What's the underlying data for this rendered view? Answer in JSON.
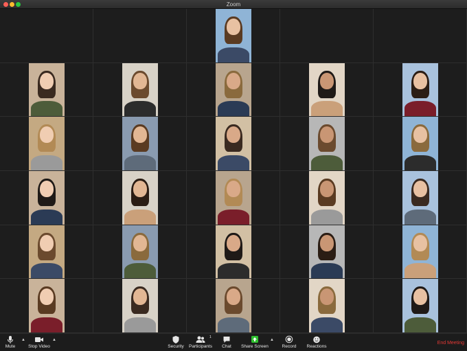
{
  "window": {
    "title": "Zoom"
  },
  "colors": {
    "end_meeting": "#e53935",
    "share_screen": "#2fbf2f",
    "toolbar_bg": "#1c1c1c",
    "grid_bg": "#1d1d1d"
  },
  "participants_count": "1",
  "toolbar": {
    "mute": "Mute",
    "stop_video": "Stop Video",
    "security": "Security",
    "participants": "Participants",
    "chat": "Chat",
    "share_screen": "Share Screen",
    "record": "Record",
    "reactions": "Reactions",
    "end_meeting": "End Meeting"
  },
  "icons": {
    "mute": "microphone-icon",
    "stop_video": "video-camera-icon",
    "security": "shield-icon",
    "participants": "participants-icon",
    "chat": "chat-bubble-icon",
    "share_screen": "share-screen-arrow-icon",
    "record": "record-icon",
    "reactions": "smiley-icon"
  }
}
